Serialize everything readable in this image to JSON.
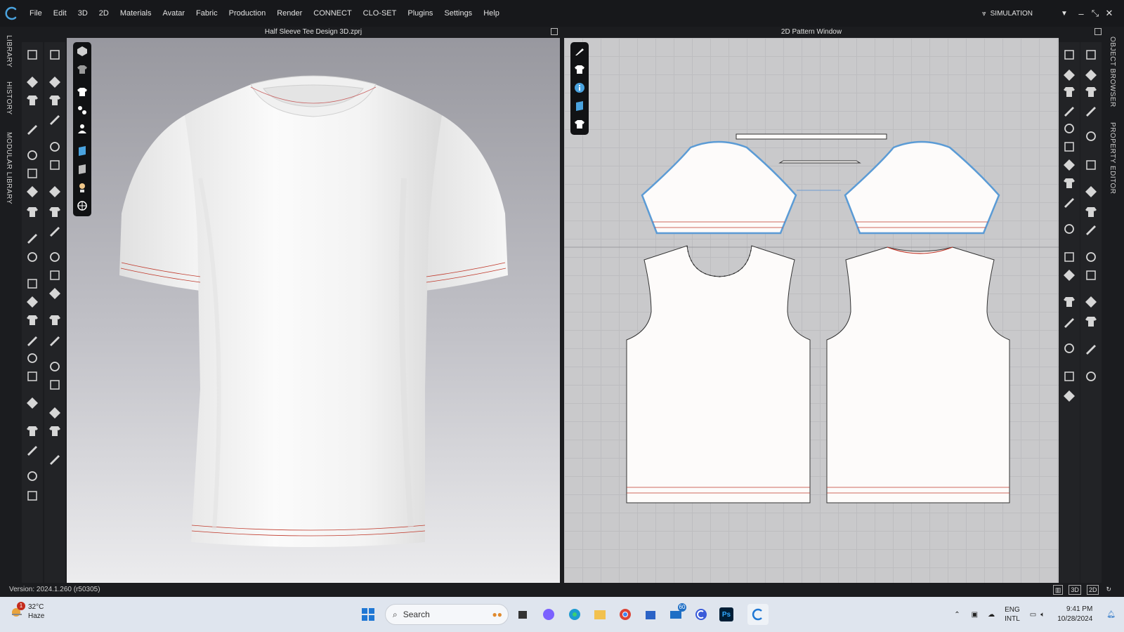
{
  "app": {
    "menu": [
      "File",
      "Edit",
      "3D",
      "2D",
      "Materials",
      "Avatar",
      "Fabric",
      "Production",
      "Render",
      "CONNECT",
      "CLO-SET",
      "Plugins",
      "Settings",
      "Help"
    ],
    "mode": "SIMULATION",
    "colors": {
      "accent": "#5b9bd5",
      "stitch": "#c0392b",
      "panel": "#222326"
    }
  },
  "left_dock": {
    "tabs": [
      "LIBRARY",
      "HISTORY",
      "MODULAR LIBRARY"
    ]
  },
  "right_dock": {
    "tabs": [
      "OBJECT BROWSER",
      "PROPERTY EDITOR"
    ]
  },
  "view3d": {
    "title": "Half Sleeve Tee Design 3D.zprj"
  },
  "view2d": {
    "title": "2D Pattern Window"
  },
  "status": {
    "version": "Version: 2024.1.260 (r50305)",
    "view_modes": [
      "3D",
      "2D"
    ]
  },
  "taskbar": {
    "weather_badge": "1",
    "temperature": "32°C",
    "condition": "Haze",
    "search_placeholder": "Search",
    "mail_badge": "60",
    "ps_label": "Ps",
    "lang_1": "ENG",
    "lang_2": "INTL",
    "time": "9:41 PM",
    "date": "10/28/2024"
  }
}
